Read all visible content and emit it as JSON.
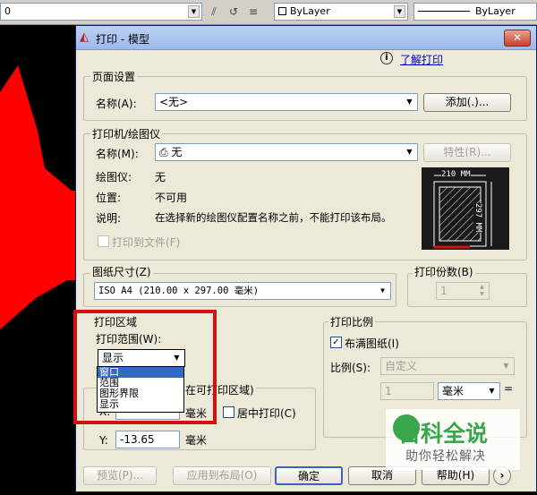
{
  "cad": {
    "layer_value": "0",
    "color_value": "ByLayer",
    "linetype_value": "ByLayer"
  },
  "dialog": {
    "title": "打印 - 模型",
    "close_label": "✕",
    "help_link": "了解打印",
    "page_setup": {
      "group_label": "页面设置",
      "name_label": "名称(A):",
      "name_value": "<无>",
      "add_button": "添加(.)..."
    },
    "plotter": {
      "group_label": "打印机/绘图仪",
      "name_label": "名称(M):",
      "name_value": "无",
      "properties_button": "特性(R)...",
      "plotter_label": "绘图仪:",
      "plotter_value": "无",
      "location_label": "位置:",
      "location_value": "不可用",
      "description_label": "说明:",
      "description_value": "在选择新的绘图仪配置名称之前，不能打印该布局。",
      "print_to_file": "打印到文件(F)",
      "preview_width": "210 MM",
      "preview_height": "297 MM"
    },
    "paper_size": {
      "group_label": "图纸尺寸(Z)",
      "value": "ISO A4 (210.00 x 297.00 毫米)"
    },
    "copies": {
      "group_label": "打印份数(B)",
      "value": "1"
    },
    "plot_area": {
      "group_label": "打印区域",
      "range_label": "打印范围(W):",
      "range_value": "显示",
      "options": [
        "窗口",
        "范围",
        "图形界限",
        "显示"
      ]
    },
    "plot_offset": {
      "group_label_visible": "在可打印区域)",
      "x_label": "X:",
      "x_unit": "毫米",
      "y_label": "Y:",
      "y_value": "-13.65",
      "y_unit": "毫米",
      "center_plot": "居中打印(C)"
    },
    "plot_scale": {
      "group_label": "打印比例",
      "fit_paper": "布满图纸(I)",
      "scale_label": "比例(S):",
      "scale_value": "自定义",
      "value1": "1",
      "unit1": "毫米",
      "equals": "="
    },
    "footer": {
      "preview": "预览(P)...",
      "apply_layout": "应用到布局(O)",
      "ok": "确定",
      "cancel": "取消",
      "help": "帮助(H)",
      "expand": "›"
    }
  },
  "watermark": {
    "title": "百科全说",
    "subtitle": "助你轻松解决"
  },
  "colors": {
    "highlight_box": "#d21010",
    "selection": "#316ac5"
  }
}
